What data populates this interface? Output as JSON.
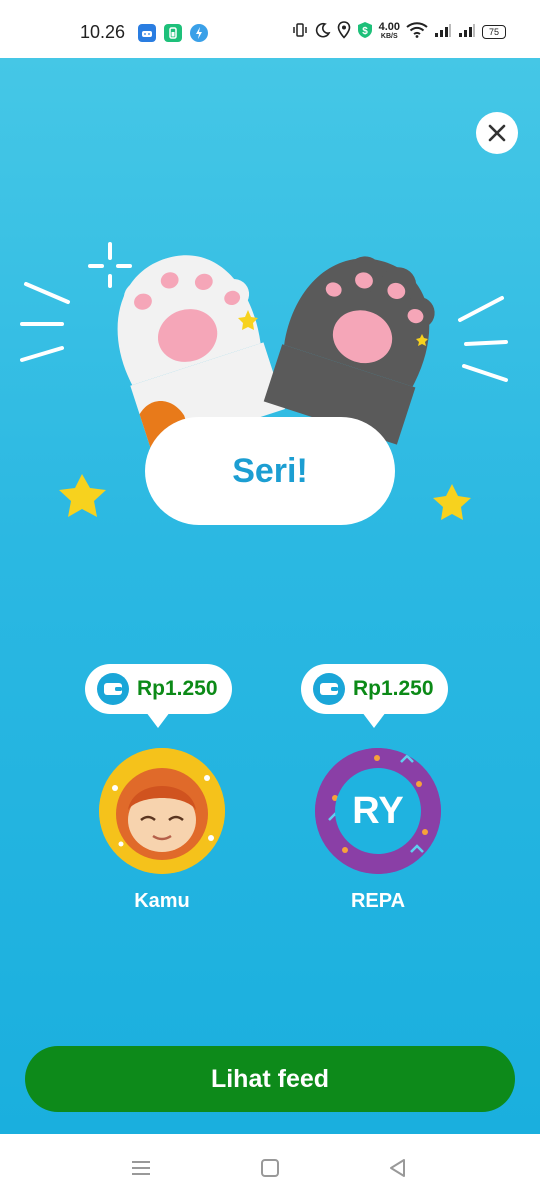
{
  "status_bar": {
    "time": "10.26",
    "net_speed_value": "4.00",
    "net_speed_unit": "KB/S",
    "battery": "75"
  },
  "result": {
    "label": "Seri!"
  },
  "players": [
    {
      "name": "Kamu",
      "reward": "Rp1.250"
    },
    {
      "name": "REPA",
      "reward": "Rp1.250",
      "initials": "RY"
    }
  ],
  "actions": {
    "view_feed_label": "Lihat feed"
  },
  "colors": {
    "background_top": "#45c7e6",
    "background_bottom": "#1aafde",
    "result_text": "#1c9ed2",
    "reward_text": "#0c8a17",
    "primary_button": "#0d8a1a"
  }
}
